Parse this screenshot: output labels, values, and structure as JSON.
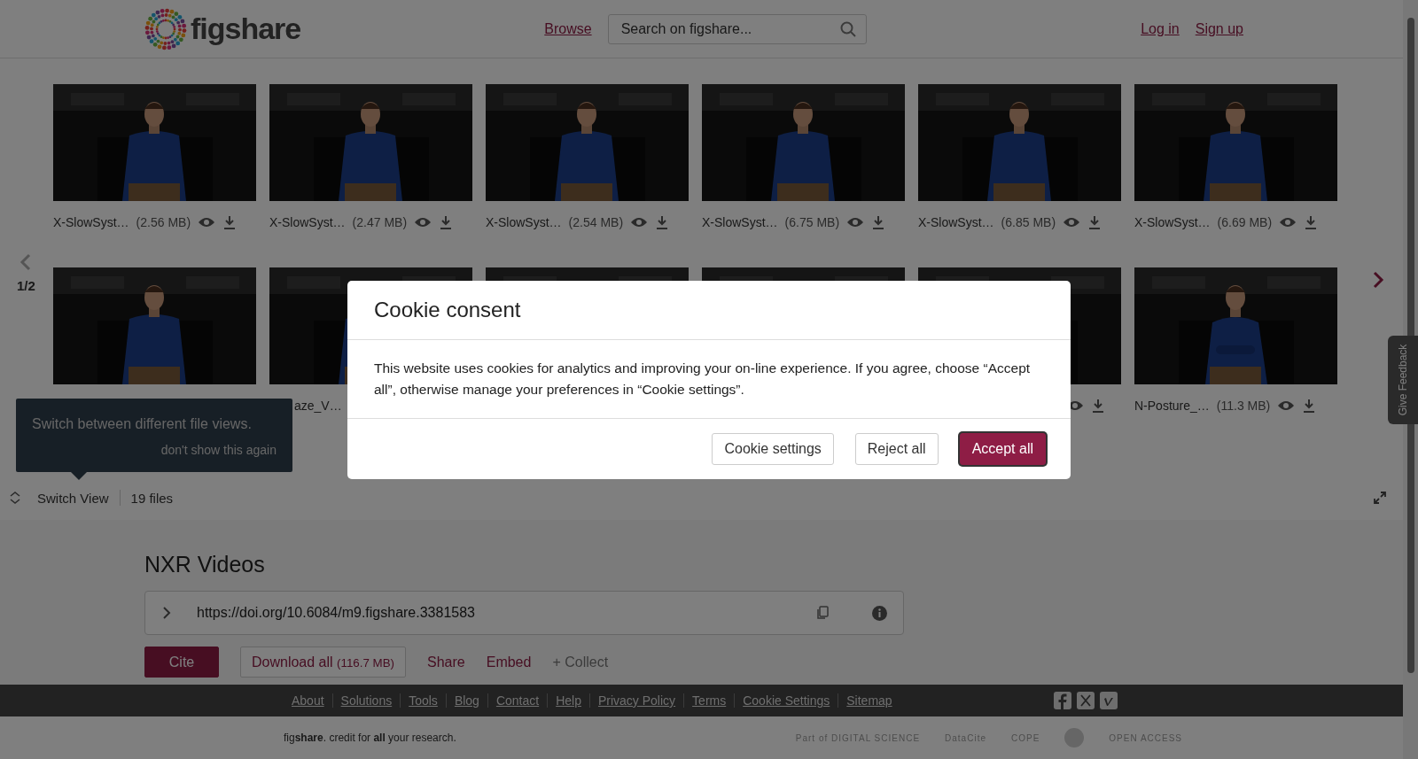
{
  "header": {
    "logo": "figshare",
    "browse": "Browse",
    "search": {
      "placeholder": "Search on figshare..."
    },
    "login": "Log in",
    "signup": "Sign up"
  },
  "gallery": {
    "page": "1/2",
    "rows": [
      [
        {
          "name": "X-SlowSyst…",
          "size": "(2.56 MB)"
        },
        {
          "name": "X-SlowSyst…",
          "size": "(2.47 MB)"
        },
        {
          "name": "X-SlowSyst…",
          "size": "(2.54 MB)"
        },
        {
          "name": "X-SlowSyst…",
          "size": "(6.75 MB)"
        },
        {
          "name": "X-SlowSyst…",
          "size": "(6.85 MB)"
        },
        {
          "name": "X-SlowSyst…",
          "size": "(6.69 MB)"
        }
      ],
      [
        {
          "kind": "hidden"
        },
        {
          "kind": "name",
          "name": "aze_V…"
        },
        {
          "kind": "hidden"
        },
        {
          "kind": "hidden"
        },
        {
          "kind": "icons"
        },
        {
          "kind": "full",
          "name": "N-Posture_…",
          "size": "(11.3 MB)"
        }
      ]
    ]
  },
  "tooltip": {
    "text": "Switch between different file views.",
    "dismiss": "don't show this again"
  },
  "file_bar": {
    "switch_view": "Switch View",
    "count": "19 files"
  },
  "item": {
    "title": "NXR Videos",
    "doi": "https://doi.org/10.6084/m9.figshare.3381583",
    "cite": "Cite",
    "download": "Download all",
    "download_size": "(116.7 MB)",
    "share": "Share",
    "embed": "Embed",
    "collect": "+ Collect"
  },
  "footer": {
    "links": [
      "About",
      "Solutions",
      "Tools",
      "Blog",
      "Contact",
      "Help",
      "Privacy Policy",
      "Terms",
      "Cookie Settings",
      "Sitemap"
    ],
    "tagline": "fig**share**. credit for **all** your research.",
    "partners": [
      "Part of DIGITAL SCIENCE",
      "DataCite",
      "COPE",
      "OPEN ACCESS"
    ]
  },
  "feedback": "Give Feedback",
  "cookie": {
    "title": "Cookie consent",
    "body": "This website uses cookies for analytics and improving your on-line experience. If you agree, choose “Accept all”, otherwise manage your preferences in “Cookie settings”.",
    "buttons": [
      {
        "label": "Cookie settings",
        "primary": false
      },
      {
        "label": "Reject all",
        "primary": false
      },
      {
        "label": "Accept all",
        "primary": true
      }
    ]
  }
}
